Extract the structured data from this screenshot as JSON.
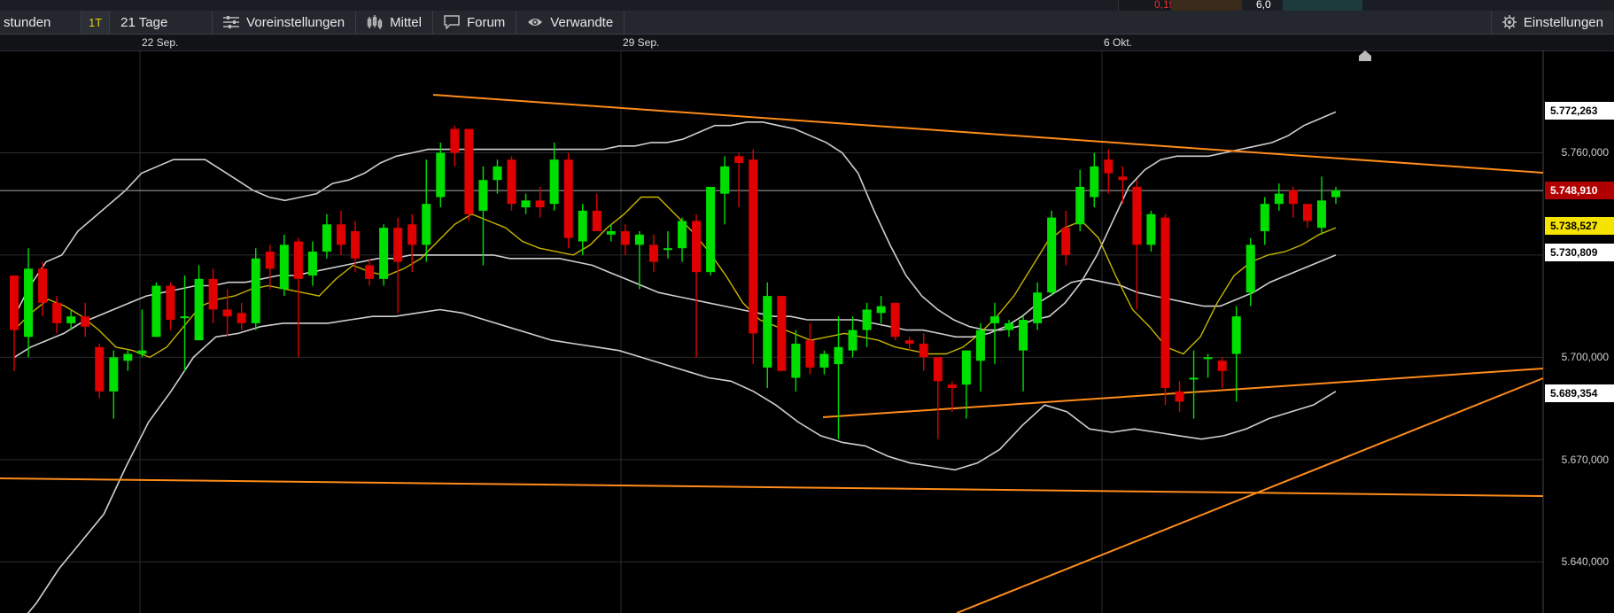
{
  "top_strip": {
    "change": "0,19",
    "value": "6,0"
  },
  "toolbar": {
    "interval_label": "stunden",
    "period_badge": "1T",
    "period_label": "21 Tage",
    "settings_label": "Voreinstellungen",
    "indicators_label": "Mittel",
    "forum_label": "Forum",
    "related_label": "Verwandte",
    "preferences_label": "Einstellungen"
  },
  "colors": {
    "up": "#00e000",
    "down": "#e00000",
    "trendline": "#ff8c1a",
    "bollinger": "#cfcfcf",
    "moving_average": "#c8b400"
  },
  "chart_data": {
    "type": "candlestick",
    "x_labels": [
      "22 Sep.",
      "29 Sep.",
      "6 Okt."
    ],
    "y_ticks": [
      "5.760,000",
      "5.700,000",
      "5.670,000",
      "5.640,000"
    ],
    "ylim": [
      5625,
      5790
    ],
    "price_labels": [
      {
        "text": "5.772,263",
        "value": 5772.263,
        "style": "white"
      },
      {
        "text": "5.748,910",
        "value": 5748.91,
        "style": "red"
      },
      {
        "text": "5.738,527",
        "value": 5738.527,
        "style": "yellow"
      },
      {
        "text": "5.730,809",
        "value": 5730.809,
        "style": "white"
      },
      {
        "text": "5.689,354",
        "value": 5689.354,
        "style": "white"
      }
    ],
    "candles": [
      [
        5724,
        5708,
        5720,
        5696
      ],
      [
        5706,
        5726,
        5732,
        5700
      ],
      [
        5726,
        5716,
        5728,
        5712
      ],
      [
        5716,
        5710,
        5718,
        5707
      ],
      [
        5710,
        5712,
        5714,
        5708
      ],
      [
        5712,
        5709,
        5716,
        5706
      ],
      [
        5703,
        5690,
        5704,
        5688
      ],
      [
        5690,
        5700,
        5702,
        5682
      ],
      [
        5699,
        5701,
        5702,
        5696
      ],
      [
        5701,
        5702,
        5714,
        5700
      ],
      [
        5706,
        5721,
        5722,
        5706
      ],
      [
        5721,
        5711,
        5722,
        5708
      ],
      [
        5712,
        5712,
        5724,
        5696
      ],
      [
        5705,
        5723,
        5727,
        5705
      ],
      [
        5723,
        5714,
        5726,
        5710
      ],
      [
        5714,
        5712,
        5720,
        5706
      ],
      [
        5713,
        5710,
        5716,
        5708
      ],
      [
        5710,
        5729,
        5732,
        5708
      ],
      [
        5731,
        5726,
        5733,
        5720
      ],
      [
        5720,
        5733,
        5736,
        5718
      ],
      [
        5734,
        5723,
        5735,
        5700
      ],
      [
        5724,
        5731,
        5734,
        5721
      ],
      [
        5731,
        5739,
        5742,
        5729
      ],
      [
        5739,
        5733,
        5743,
        5730
      ],
      [
        5737,
        5729,
        5740,
        5725
      ],
      [
        5727,
        5723,
        5729,
        5721
      ],
      [
        5723,
        5738,
        5739,
        5721
      ],
      [
        5738,
        5728,
        5741,
        5713
      ],
      [
        5739,
        5733,
        5742,
        5725
      ],
      [
        5733,
        5745,
        5758,
        5728
      ],
      [
        5747,
        5760,
        5763,
        5744
      ],
      [
        5767,
        5760,
        5768,
        5756
      ],
      [
        5767,
        5742,
        5767,
        5740
      ],
      [
        5743,
        5752,
        5756,
        5727
      ],
      [
        5752,
        5756,
        5758,
        5748
      ],
      [
        5758,
        5745,
        5759,
        5743
      ],
      [
        5744,
        5746,
        5748,
        5742
      ],
      [
        5746,
        5744,
        5750,
        5741
      ],
      [
        5745,
        5758,
        5763,
        5743
      ],
      [
        5758,
        5735,
        5760,
        5732
      ],
      [
        5734,
        5743,
        5745,
        5730
      ],
      [
        5743,
        5737,
        5748,
        5737
      ],
      [
        5736,
        5737,
        5739,
        5734
      ],
      [
        5737,
        5733,
        5739,
        5730
      ],
      [
        5733,
        5736,
        5737,
        5720
      ],
      [
        5733,
        5728,
        5736,
        5725
      ],
      [
        5732,
        5732,
        5737,
        5729
      ],
      [
        5732,
        5740,
        5741,
        5728
      ],
      [
        5740,
        5725,
        5742,
        5700
      ],
      [
        5725,
        5750,
        5750,
        5724
      ],
      [
        5748,
        5756,
        5759,
        5739
      ],
      [
        5759,
        5757,
        5760,
        5744
      ],
      [
        5758,
        5707,
        5761,
        5698
      ],
      [
        5697,
        5718,
        5722,
        5691
      ],
      [
        5718,
        5696,
        5718,
        5696
      ],
      [
        5694,
        5704,
        5708,
        5690
      ],
      [
        5705,
        5697,
        5710,
        5695
      ],
      [
        5697,
        5701,
        5702,
        5695
      ],
      [
        5698,
        5703,
        5712,
        5676
      ],
      [
        5702,
        5708,
        5712,
        5700
      ],
      [
        5708,
        5714,
        5716,
        5703
      ],
      [
        5713,
        5715,
        5718,
        5710
      ],
      [
        5716,
        5706,
        5716,
        5705
      ],
      [
        5705,
        5704,
        5706,
        5702
      ],
      [
        5704,
        5700,
        5707,
        5696
      ],
      [
        5700,
        5693,
        5700,
        5676
      ],
      [
        5692,
        5691,
        5693,
        5684
      ],
      [
        5692,
        5702,
        5702,
        5682
      ],
      [
        5699,
        5708,
        5710,
        5690
      ],
      [
        5710,
        5712,
        5716,
        5698
      ],
      [
        5708,
        5710,
        5711,
        5706
      ],
      [
        5702,
        5711,
        5712,
        5690
      ],
      [
        5710,
        5719,
        5722,
        5708
      ],
      [
        5719,
        5741,
        5743,
        5718
      ],
      [
        5738,
        5730,
        5743,
        5727
      ],
      [
        5739,
        5750,
        5755,
        5737
      ],
      [
        5747,
        5756,
        5760,
        5744
      ],
      [
        5758,
        5754,
        5761,
        5748
      ],
      [
        5753,
        5752,
        5756,
        5745
      ],
      [
        5750,
        5733,
        5752,
        5714
      ],
      [
        5733,
        5742,
        5743,
        5731
      ],
      [
        5741,
        5691,
        5742,
        5686
      ],
      [
        5690,
        5687,
        5693,
        5684
      ],
      [
        5694,
        5694,
        5702,
        5682
      ],
      [
        5700,
        5700,
        5701,
        5694
      ],
      [
        5699,
        5696,
        5700,
        5691
      ],
      [
        5701,
        5712,
        5715,
        5687
      ],
      [
        5719,
        5733,
        5735,
        5715
      ],
      [
        5737,
        5745,
        5747,
        5733
      ],
      [
        5745,
        5748,
        5751,
        5743
      ],
      [
        5749,
        5745,
        5750,
        5741
      ],
      [
        5745,
        5740,
        5744,
        5738
      ],
      [
        5738,
        5746,
        5753,
        5736
      ],
      [
        5747,
        5749,
        5750,
        5745
      ]
    ],
    "bollinger_upper": [
      5712,
      5721,
      5728,
      5730,
      5737,
      5741,
      5745,
      5749,
      5754,
      5756,
      5758,
      5758,
      5758,
      5755,
      5752,
      5749,
      5747,
      5746,
      5747,
      5748,
      5751,
      5752,
      5754,
      5757,
      5759,
      5760,
      5761,
      5761,
      5761,
      5761,
      5761,
      5761,
      5761,
      5761,
      5761,
      5761,
      5761,
      5761,
      5762,
      5762,
      5763,
      5763,
      5764,
      5766,
      5768,
      5768,
      5769,
      5769,
      5768,
      5767,
      5765,
      5763,
      5760,
      5754,
      5743,
      5733,
      5724,
      5718,
      5714,
      5711,
      5709,
      5708,
      5708,
      5709,
      5711,
      5712,
      5716,
      5722,
      5730,
      5740,
      5750,
      5755,
      5758,
      5759,
      5759,
      5759,
      5760,
      5761,
      5762,
      5763,
      5765,
      5768,
      5770,
      5772
    ],
    "bollinger_mid": [
      5700,
      5703,
      5705,
      5707,
      5710,
      5712,
      5714,
      5716,
      5718,
      5719,
      5720,
      5721,
      5721,
      5722,
      5722,
      5723,
      5724,
      5724,
      5725,
      5726,
      5727,
      5728,
      5729,
      5729,
      5730,
      5730,
      5730,
      5730,
      5730,
      5730,
      5729,
      5729,
      5729,
      5729,
      5728,
      5727,
      5725,
      5723,
      5721,
      5719,
      5718,
      5717,
      5716,
      5715,
      5714,
      5713,
      5712,
      5712,
      5711,
      5711,
      5711,
      5711,
      5710,
      5709,
      5708,
      5708,
      5707,
      5706,
      5706,
      5707,
      5709,
      5712,
      5716,
      5719,
      5722,
      5723,
      5722,
      5721,
      5719,
      5718,
      5717,
      5716,
      5715,
      5715,
      5717,
      5719,
      5722,
      5724,
      5726,
      5728,
      5730
    ],
    "bollinger_lower": [
      5620,
      5628,
      5638,
      5646,
      5654,
      5668,
      5681,
      5690,
      5700,
      5706,
      5707,
      5709,
      5710,
      5710,
      5710,
      5711,
      5712,
      5712,
      5713,
      5714,
      5713,
      5711,
      5709,
      5707,
      5705,
      5704,
      5703,
      5702,
      5700,
      5698,
      5696,
      5694,
      5693,
      5690,
      5686,
      5681,
      5677,
      5675,
      5674,
      5671,
      5669,
      5668,
      5667,
      5669,
      5673,
      5680,
      5686,
      5684,
      5679,
      5678,
      5679,
      5678,
      5677,
      5676,
      5677,
      5679,
      5682,
      5684,
      5686,
      5690
    ],
    "moving_average": [
      5708,
      5713,
      5717,
      5715,
      5712,
      5708,
      5703,
      5702,
      5700,
      5703,
      5709,
      5715,
      5717,
      5718,
      5720,
      5721,
      5720,
      5719,
      5718,
      5723,
      5727,
      5725,
      5724,
      5726,
      5729,
      5734,
      5739,
      5742,
      5740,
      5738,
      5734,
      5732,
      5731,
      5730,
      5733,
      5738,
      5742,
      5747,
      5747,
      5742,
      5737,
      5731,
      5724,
      5716,
      5711,
      5709,
      5707,
      5705,
      5706,
      5707,
      5706,
      5705,
      5703,
      5702,
      5701,
      5701,
      5703,
      5707,
      5712,
      5718,
      5726,
      5734,
      5738,
      5740,
      5735,
      5724,
      5714,
      5709,
      5703,
      5701,
      5706,
      5716,
      5724,
      5728,
      5730,
      5731,
      5733,
      5736,
      5738
    ]
  }
}
